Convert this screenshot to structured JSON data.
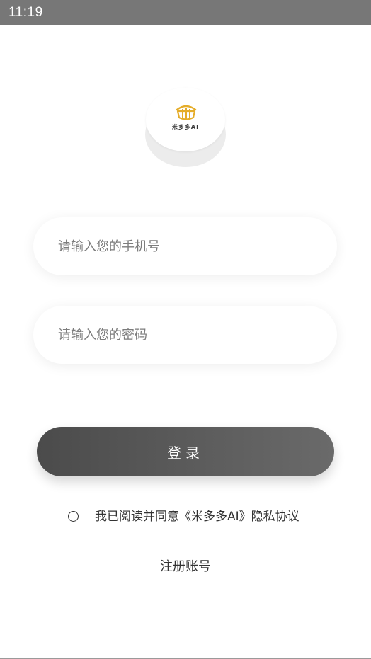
{
  "status_bar": {
    "time": "11:19"
  },
  "logo": {
    "icon": "mibo-logo-icon",
    "text": "米多多AI",
    "accent_color": "#e5ad2a"
  },
  "form": {
    "phone_placeholder": "请输入您的手机号",
    "phone_value": "",
    "password_placeholder": "请输入您的密码",
    "password_value": ""
  },
  "login_button": {
    "label": "登录"
  },
  "agreement": {
    "checked": false,
    "text": "我已阅读并同意《米多多AI》隐私协议"
  },
  "register": {
    "label": "注册账号"
  },
  "colors": {
    "button_start": "#4b4b4b",
    "button_end": "#6a6a6a",
    "status_bar": "#777777"
  }
}
